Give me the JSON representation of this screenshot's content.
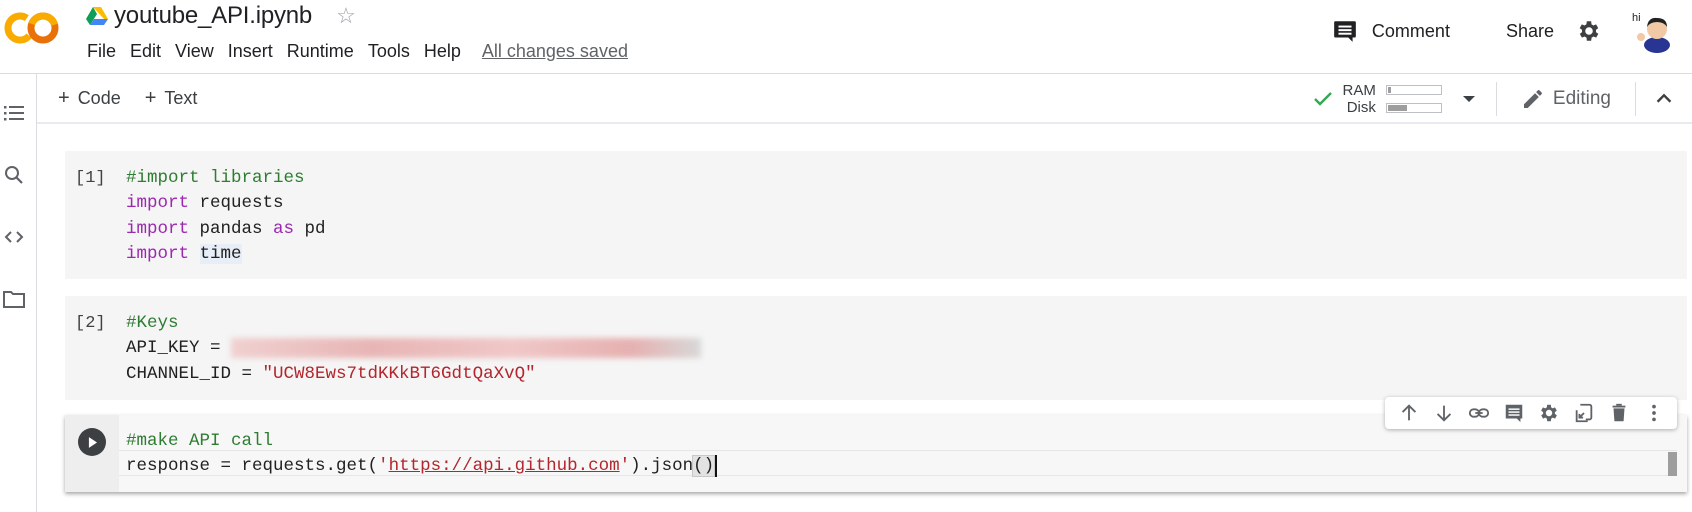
{
  "app": {
    "logo": "colab-logo",
    "doc_title": "youtube_API.ipynb",
    "star_icon": "☆",
    "save_status": "All changes saved"
  },
  "menu": [
    {
      "label": "File"
    },
    {
      "label": "Edit"
    },
    {
      "label": "View"
    },
    {
      "label": "Insert"
    },
    {
      "label": "Runtime"
    },
    {
      "label": "Tools"
    },
    {
      "label": "Help"
    }
  ],
  "header_right": {
    "comment_label": "Comment",
    "share_label": "Share",
    "avatar_text": "hi"
  },
  "sidebar": {
    "icons": [
      "table-of-contents-icon",
      "search-icon",
      "code-snippets-icon",
      "files-icon"
    ]
  },
  "toolbar": {
    "add_code_label": "Code",
    "add_text_label": "Text",
    "plus": "+",
    "ram_label": "RAM",
    "disk_label": "Disk",
    "ram_usage_fraction": 0.05,
    "disk_usage_fraction": 0.35,
    "connection_status": "connected",
    "editing_label": "Editing"
  },
  "cells": [
    {
      "exec_count": "[1]",
      "lines": [
        [
          {
            "t": "#import libraries",
            "c": "comment"
          }
        ],
        [
          {
            "t": "import",
            "c": "kw"
          },
          {
            "t": " requests",
            "c": ""
          }
        ],
        [
          {
            "t": "import",
            "c": "kw"
          },
          {
            "t": " pandas ",
            "c": ""
          },
          {
            "t": "as",
            "c": "kw"
          },
          {
            "t": " pd",
            "c": ""
          }
        ],
        [
          {
            "t": "import",
            "c": "kw"
          },
          {
            "t": " ",
            "c": ""
          },
          {
            "t": "time",
            "c": "hl"
          }
        ]
      ]
    },
    {
      "exec_count": "[2]",
      "lines": [
        [
          {
            "t": "#Keys",
            "c": "comment"
          }
        ],
        [
          {
            "t": "API_KEY = ",
            "c": ""
          },
          {
            "t": "",
            "c": "blur"
          }
        ],
        [
          {
            "t": "CHANNEL_ID = ",
            "c": ""
          },
          {
            "t": "\"UCW8Ews7tdKKkBT6GdtQaXvQ\"",
            "c": "str"
          }
        ]
      ]
    },
    {
      "exec_count": "",
      "lines": [
        [
          {
            "t": "#make API call",
            "c": "comment"
          }
        ],
        [
          {
            "t": "response = requests.get(",
            "c": ""
          },
          {
            "t": "'",
            "c": "str"
          },
          {
            "t": "https://api.github.com",
            "c": "url"
          },
          {
            "t": "'",
            "c": "str"
          },
          {
            "t": ").json",
            "c": ""
          },
          {
            "t": "()",
            "c": "paren"
          }
        ]
      ]
    }
  ],
  "cell_toolbar": {
    "icons": [
      "move-up-icon",
      "move-down-icon",
      "link-icon",
      "comment-icon",
      "settings-icon",
      "mirror-cell-icon",
      "delete-icon",
      "more-icon"
    ]
  }
}
